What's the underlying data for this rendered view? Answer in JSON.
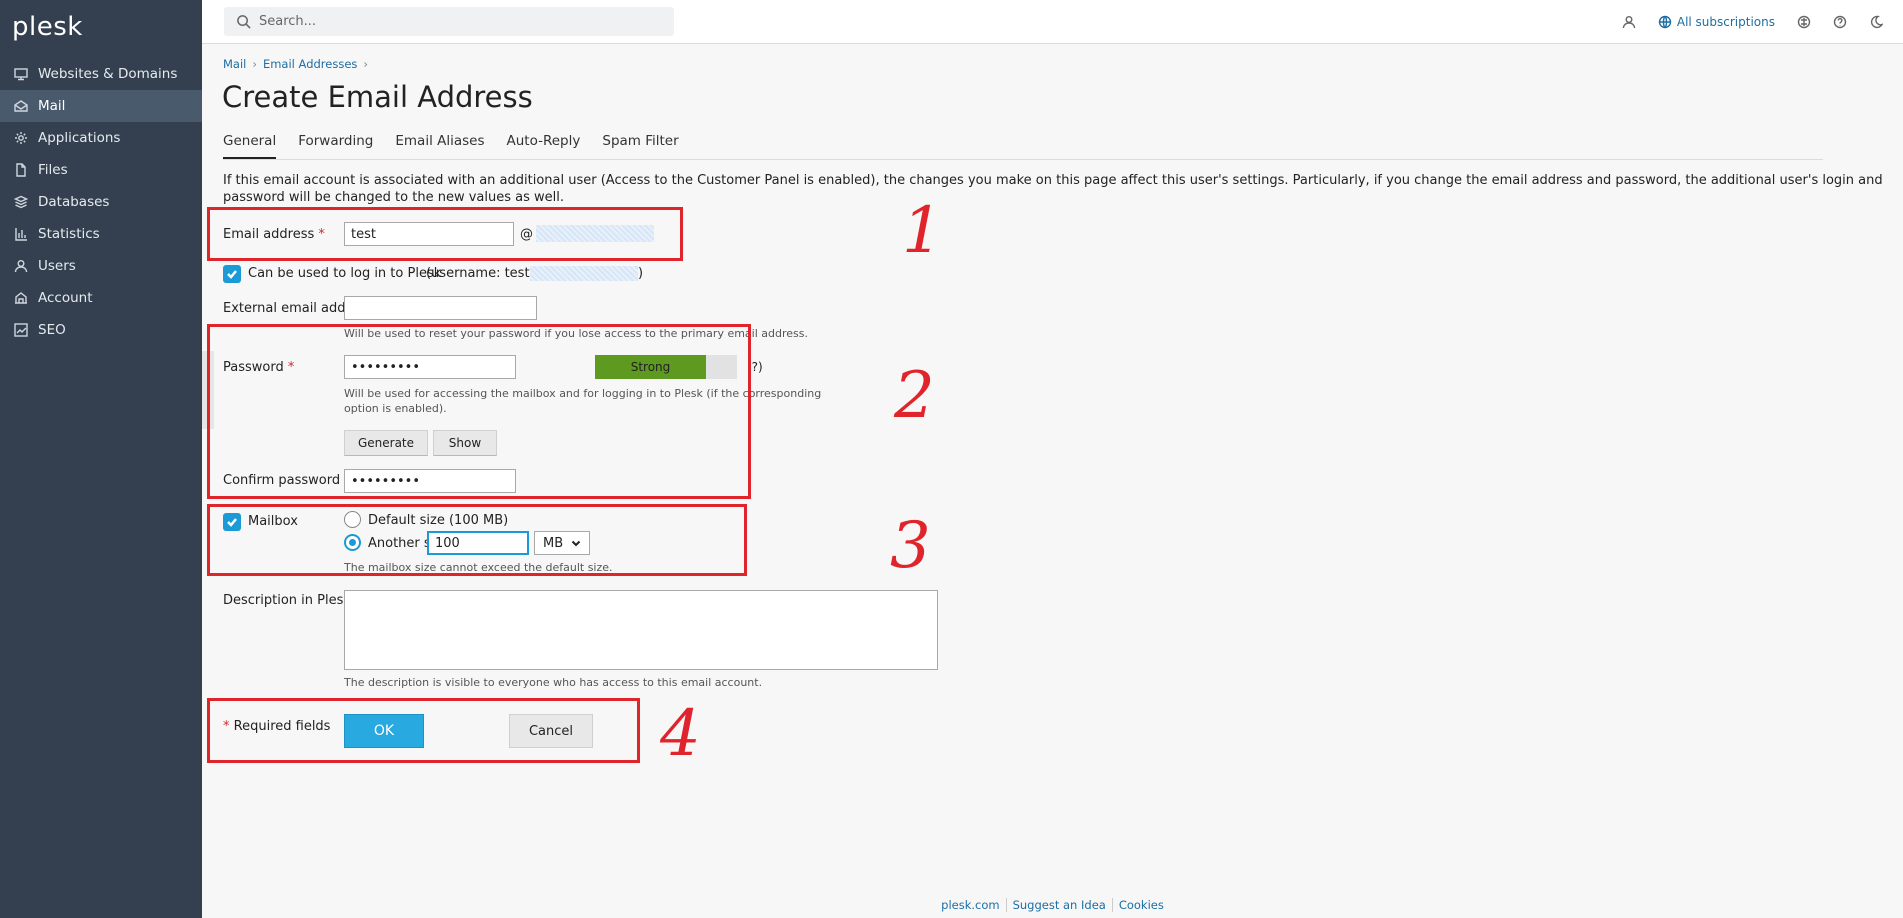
{
  "app": {
    "logo": "plesk"
  },
  "sidebar": {
    "items": [
      {
        "label": "Websites & Domains",
        "icon": "monitor-icon"
      },
      {
        "label": "Mail",
        "icon": "mail-icon",
        "active": true
      },
      {
        "label": "Applications",
        "icon": "gear-icon"
      },
      {
        "label": "Files",
        "icon": "file-icon"
      },
      {
        "label": "Databases",
        "icon": "database-icon"
      },
      {
        "label": "Statistics",
        "icon": "bar-chart-icon"
      },
      {
        "label": "Users",
        "icon": "user-icon"
      },
      {
        "label": "Account",
        "icon": "account-icon"
      },
      {
        "label": "SEO",
        "icon": "seo-icon"
      }
    ]
  },
  "topbar": {
    "search_placeholder": "Search...",
    "subscriptions_label": "All subscriptions"
  },
  "breadcrumb": {
    "items": [
      "Mail",
      "Email Addresses"
    ]
  },
  "page_title": "Create Email Address",
  "tabs": [
    "General",
    "Forwarding",
    "Email Aliases",
    "Auto-Reply",
    "Spam Filter"
  ],
  "note": "If this email account is associated with an additional user (Access to the Customer Panel is enabled), the changes you make on this page affect this user's settings. Particularly, if you change the email address and password, the additional user's login and password will be changed to the new values as well.",
  "form": {
    "email_label": "Email address",
    "email_value": "test",
    "at_sign": "@",
    "login_checkbox_label": "Can be used to log in to Plesk",
    "login_username_prefix": "(username: test@",
    "login_username_suffix": ")",
    "external_email_label": "External email address",
    "external_email_value": "",
    "external_email_hint": "Will be used to reset your password if you lose access to the primary email address.",
    "password_label": "Password",
    "password_value": "•••••••••",
    "strength_label": "Strength",
    "strength_text": "Strong",
    "strength_level": 0.78,
    "password_help": "(?)",
    "password_hint_line1": "Will be used for accessing the mailbox and for logging in to Plesk (if the corresponding",
    "password_hint_line2": "option is enabled).",
    "generate_label": "Generate",
    "show_label": "Show",
    "confirm_label": "Confirm password",
    "confirm_value": "•••••••••",
    "mailbox_label": "Mailbox",
    "default_size_label": "Default size (100 MB)",
    "another_size_label": "Another size",
    "another_size_value": "100",
    "size_unit": "MB",
    "mailbox_hint": "The mailbox size cannot exceed the default size.",
    "description_label": "Description in Plesk",
    "description_hint": "The description is visible to everyone who has access to this email account.",
    "required_asterisk": "*",
    "required_fields_label": "Required fields",
    "ok_label": "OK",
    "cancel_label": "Cancel"
  },
  "annotations": [
    "1",
    "2",
    "3",
    "4"
  ],
  "footer": {
    "links": [
      "plesk.com",
      "Suggest an Idea",
      "Cookies"
    ]
  },
  "colors": {
    "accent": "#1a9bd7",
    "sidebar": "#34404f",
    "annotation": "#e0242c",
    "strength": "#5e9a20"
  }
}
